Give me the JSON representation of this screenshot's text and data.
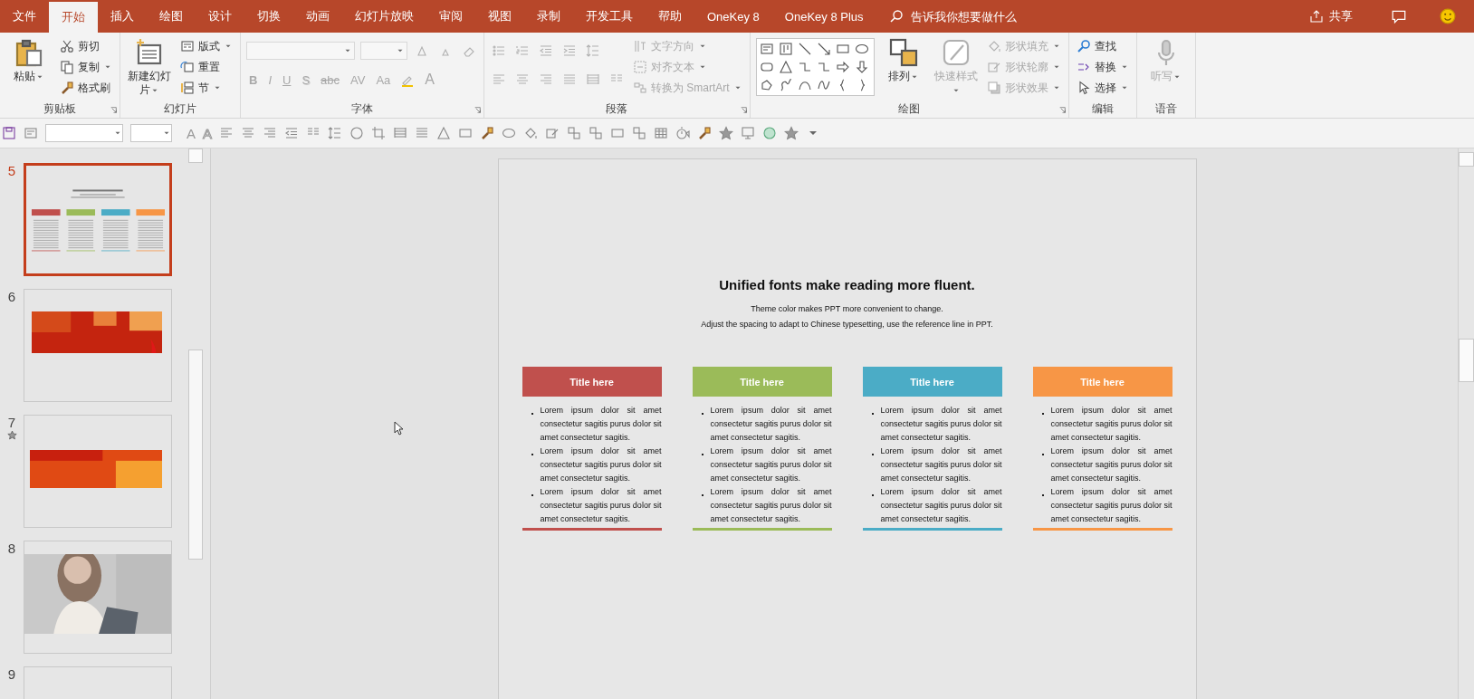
{
  "tabs": [
    {
      "label": "文件",
      "selected": false
    },
    {
      "label": "开始",
      "selected": true
    },
    {
      "label": "插入",
      "selected": false
    },
    {
      "label": "绘图",
      "selected": false
    },
    {
      "label": "设计",
      "selected": false
    },
    {
      "label": "切换",
      "selected": false
    },
    {
      "label": "动画",
      "selected": false
    },
    {
      "label": "幻灯片放映",
      "selected": false
    },
    {
      "label": "审阅",
      "selected": false
    },
    {
      "label": "视图",
      "selected": false
    },
    {
      "label": "录制",
      "selected": false
    },
    {
      "label": "开发工具",
      "selected": false
    },
    {
      "label": "帮助",
      "selected": false
    },
    {
      "label": "OneKey 8",
      "selected": false
    },
    {
      "label": "OneKey 8 Plus",
      "selected": false
    }
  ],
  "search": {
    "placeholder": "告诉我你想要做什么"
  },
  "share": "共享",
  "ribbon": [
    {
      "label": "剪贴板",
      "launcher": true,
      "columns": [
        {
          "kind": "large",
          "label": "粘贴",
          "dropdown": true,
          "disabled": false
        },
        {
          "kind": "stack",
          "items": [
            {
              "label": "剪切",
              "dropdown": false,
              "disabled": false
            },
            {
              "label": "复制",
              "dropdown": true,
              "disabled": false
            },
            {
              "label": "格式刷",
              "dropdown": false,
              "disabled": false
            }
          ]
        }
      ]
    },
    {
      "label": "幻灯片",
      "launcher": false,
      "columns": [
        {
          "kind": "large",
          "label": "新建幻灯片",
          "dropdown": true,
          "disabled": false
        },
        {
          "kind": "stack",
          "items": [
            {
              "label": "版式",
              "dropdown": true,
              "disabled": false
            },
            {
              "label": "重置",
              "dropdown": false,
              "disabled": false
            },
            {
              "label": "节",
              "dropdown": true,
              "disabled": false
            }
          ]
        }
      ]
    },
    {
      "label": "字体",
      "launcher": true,
      "columns": [
        {
          "kind": "rows",
          "rows": [
            [
              {
                "kind": "field",
                "disabled": true
              },
              {
                "kind": "field",
                "disabled": true
              },
              {
                "kind": "icon",
                "disabled": true
              },
              {
                "kind": "icon",
                "disabled": true
              },
              {
                "kind": "icon",
                "disabled": true
              }
            ],
            [
              {
                "kind": "glyph",
                "label": "B",
                "disabled": true
              },
              {
                "kind": "glyph",
                "label": "I",
                "disabled": true
              },
              {
                "kind": "glyph",
                "label": "U",
                "disabled": true
              },
              {
                "kind": "glyph",
                "label": "S",
                "disabled": true
              },
              {
                "kind": "glyph",
                "label": "abc",
                "disabled": true
              },
              {
                "kind": "glyph",
                "label": "AV",
                "disabled": true
              },
              {
                "kind": "glyph",
                "label": "Aa",
                "disabled": true
              },
              {
                "kind": "icon",
                "disabled": true
              },
              {
                "kind": "glyph",
                "label": "A",
                "disabled": true
              }
            ]
          ]
        }
      ]
    },
    {
      "label": "段落",
      "launcher": true,
      "columns": [
        {
          "kind": "rows",
          "rows": [
            [
              {
                "kind": "icon",
                "disabled": true
              },
              {
                "kind": "icon",
                "disabled": true
              },
              {
                "kind": "icon",
                "disabled": true
              },
              {
                "kind": "icon",
                "disabled": true
              },
              {
                "kind": "icon",
                "disabled": true
              }
            ],
            [
              {
                "kind": "icon",
                "disabled": true
              },
              {
                "kind": "icon",
                "disabled": true
              },
              {
                "kind": "icon",
                "disabled": true
              },
              {
                "kind": "icon",
                "disabled": true
              },
              {
                "kind": "icon",
                "disabled": true
              },
              {
                "kind": "icon",
                "disabled": true
              }
            ]
          ]
        },
        {
          "kind": "stack",
          "items": [
            {
              "label": "文字方向",
              "dropdown": true,
              "disabled": true
            },
            {
              "label": "对齐文本",
              "dropdown": true,
              "disabled": true
            },
            {
              "label": "转换为 SmartArt",
              "dropdown": true,
              "disabled": true
            }
          ]
        }
      ]
    },
    {
      "label": "绘图",
      "launcher": true,
      "columns": [
        {
          "kind": "gallery"
        },
        {
          "kind": "large",
          "label": "排列",
          "dropdown": true,
          "disabled": false
        },
        {
          "kind": "large",
          "label": "快速样式",
          "dropdown": true,
          "disabled": true
        },
        {
          "kind": "stack",
          "items": [
            {
              "label": "形状填充",
              "dropdown": true,
              "disabled": true
            },
            {
              "label": "形状轮廓",
              "dropdown": true,
              "disabled": true
            },
            {
              "label": "形状效果",
              "dropdown": true,
              "disabled": true
            }
          ]
        }
      ]
    },
    {
      "label": "编辑",
      "launcher": false,
      "columns": [
        {
          "kind": "stack",
          "items": [
            {
              "label": "查找",
              "dropdown": false,
              "disabled": false
            },
            {
              "label": "替换",
              "dropdown": true,
              "disabled": false
            },
            {
              "label": "选择",
              "dropdown": true,
              "disabled": false
            }
          ]
        }
      ]
    },
    {
      "label": "语音",
      "launcher": false,
      "columns": [
        {
          "kind": "large",
          "label": "听写",
          "dropdown": true,
          "disabled": true
        }
      ]
    }
  ],
  "quick_toolbar": {
    "glyphs": [
      "A",
      "A"
    ]
  },
  "slides": [
    {
      "number": "5",
      "selected": true,
      "animated": false,
      "kind": "cards"
    },
    {
      "number": "6",
      "selected": false,
      "animated": false,
      "kind": "picture"
    },
    {
      "number": "7",
      "selected": false,
      "animated": true,
      "kind": "picture"
    },
    {
      "number": "8",
      "selected": false,
      "animated": false,
      "kind": "picture"
    },
    {
      "number": "9",
      "selected": false,
      "animated": false,
      "kind": "blank"
    }
  ],
  "slide": {
    "title": "Unified fonts make reading more fluent.",
    "subtitle": [
      "Theme color makes PPT more convenient to change.",
      "Adjust the spacing to adapt to Chinese typesetting, use the reference line in PPT."
    ],
    "columns": [
      {
        "title": "Title here",
        "color": "#c0504d",
        "bullets": [
          "Lorem ipsum dolor sit amet consectetur sagitis purus dolor sit amet consectetur sagitis.",
          "Lorem ipsum dolor sit amet consectetur sagitis purus dolor sit amet consectetur sagitis.",
          "Lorem ipsum dolor sit amet consectetur sagitis purus dolor sit amet consectetur sagitis."
        ]
      },
      {
        "title": "Title here",
        "color": "#9bbb59",
        "bullets": [
          "Lorem ipsum dolor sit amet consectetur sagitis purus dolor sit amet consectetur sagitis.",
          "Lorem ipsum dolor sit amet consectetur sagitis purus dolor sit amet consectetur sagitis.",
          "Lorem ipsum dolor sit amet consectetur sagitis purus dolor sit amet consectetur sagitis."
        ]
      },
      {
        "title": "Title here",
        "color": "#4bacc6",
        "bullets": [
          "Lorem ipsum dolor sit amet consectetur sagitis purus dolor sit amet consectetur sagitis.",
          "Lorem ipsum dolor sit amet consectetur sagitis purus dolor sit amet consectetur sagitis.",
          "Lorem ipsum dolor sit amet consectetur sagitis purus dolor sit amet consectetur sagitis."
        ]
      },
      {
        "title": "Title here",
        "color": "#f79646",
        "bullets": [
          "Lorem ipsum dolor sit amet consectetur sagitis purus dolor sit amet consectetur sagitis.",
          "Lorem ipsum dolor sit amet consectetur sagitis purus dolor sit amet consectetur sagitis.",
          "Lorem ipsum dolor sit amet consectetur sagitis purus dolor sit amet consectetur sagitis."
        ]
      }
    ]
  }
}
